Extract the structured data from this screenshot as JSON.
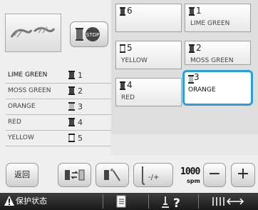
{
  "list": [
    {
      "name": "LIME GREEN",
      "num": "1",
      "spool": "dark"
    },
    {
      "name": "MOSS GREEN",
      "num": "2",
      "spool": "dark"
    },
    {
      "name": "ORANGE",
      "num": "3",
      "spool": "light"
    },
    {
      "name": "RED",
      "num": "4",
      "spool": "dark"
    },
    {
      "name": "YELLOW",
      "num": "5",
      "spool": "light"
    }
  ],
  "grid": [
    {
      "num": "6",
      "name": ""
    },
    {
      "num": "1",
      "name": "LIME GREEN"
    },
    {
      "num": "5",
      "name": "YELLOW"
    },
    {
      "num": "2",
      "name": "MOSS GREEN"
    },
    {
      "num": "4",
      "name": "RED"
    },
    {
      "num": "3",
      "name": "ORANGE"
    }
  ],
  "buttons": {
    "back": "返回",
    "speed_value": "1000",
    "speed_unit": "spm",
    "minus": "−",
    "plus": "+"
  },
  "footer": {
    "protect_label": "保护状态"
  },
  "stop_icon_text": "STOP",
  "colors": {
    "selection": "#2ba0d8",
    "footer": "#222222"
  }
}
